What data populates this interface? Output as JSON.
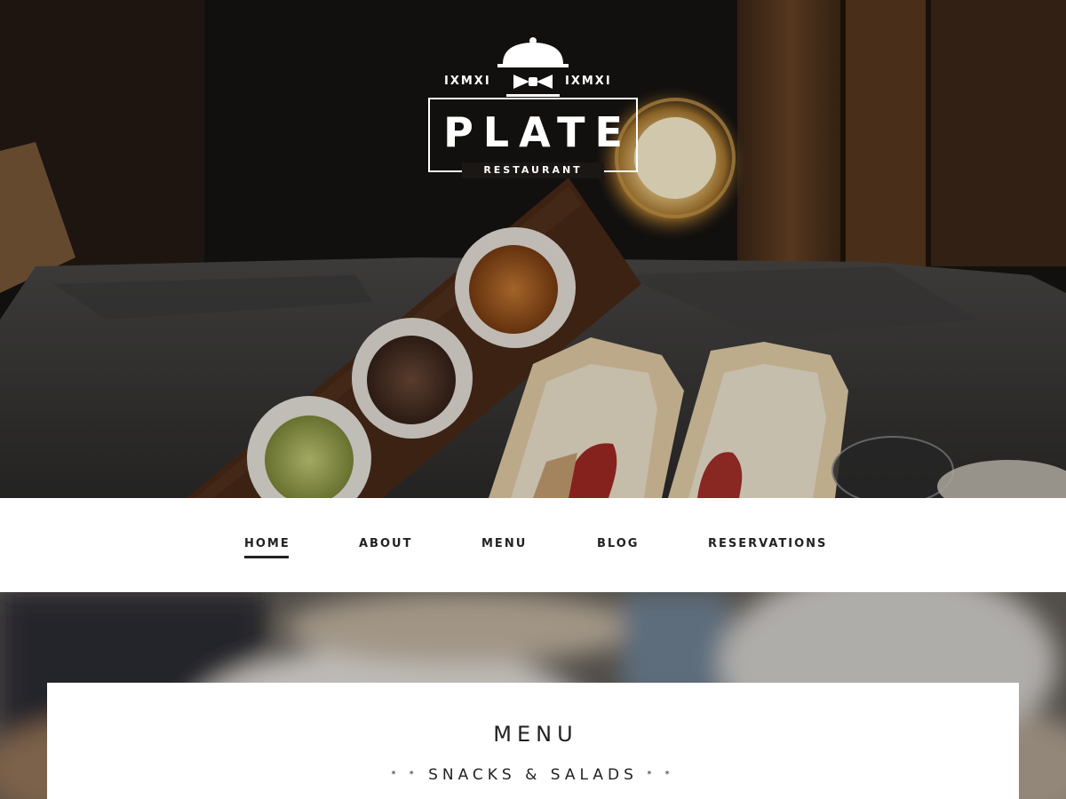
{
  "brand": {
    "year_left": "IXMXI",
    "year_right": "IXMXI",
    "name": "PLATE",
    "tagline": "RESTAURANT"
  },
  "nav": {
    "items": [
      {
        "label": "HOME",
        "active": true
      },
      {
        "label": "ABOUT",
        "active": false
      },
      {
        "label": "MENU",
        "active": false
      },
      {
        "label": "BLOG",
        "active": false
      },
      {
        "label": "RESERVATIONS",
        "active": false
      }
    ]
  },
  "menu_section": {
    "title": "MENU",
    "subtitle": "SNACKS & SALADS",
    "ornament_left": "* *",
    "ornament_right": "* *"
  },
  "icons": {
    "logo_emblem": "cloche-bowtie-icon"
  },
  "colors": {
    "text_dark": "#222222",
    "hero_background": "#161412",
    "card_background": "#ffffff"
  }
}
